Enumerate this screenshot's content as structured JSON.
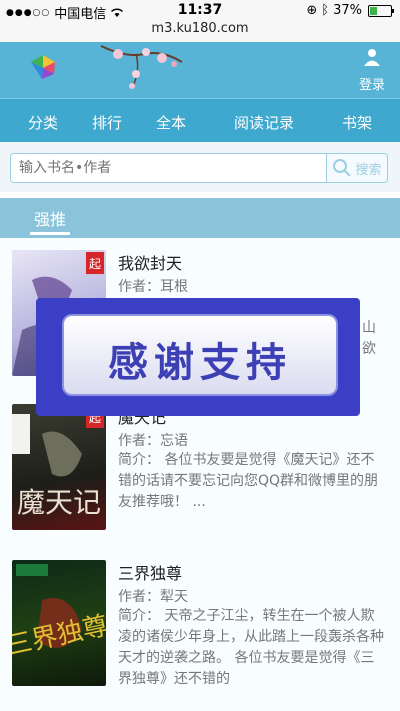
{
  "status_bar": {
    "carrier": "中国电信",
    "time": "11:37",
    "battery": "37%",
    "battery_level": 0.37
  },
  "url": "m3.ku180.com",
  "header": {
    "login_label": "登录"
  },
  "nav": {
    "items": [
      "分类",
      "排行",
      "全本",
      "阅读记录",
      "书架"
    ]
  },
  "search": {
    "placeholder": "输入书名•作者",
    "button_label": "搜索"
  },
  "section": {
    "title": "强推"
  },
  "books": [
    {
      "title": "我欲封天",
      "author": "作者：耳根",
      "summary_lines": [
        "山",
        "欲"
      ]
    },
    {
      "title": "魔天记",
      "author": "作者：忘语",
      "summary": "简介： 各位书友要是觉得《魔天记》还不错的话请不要忘记向您QQ群和微博里的朋友推荐哦！ ..."
    },
    {
      "title": "三界独尊",
      "author": "作者：犁天",
      "summary": "简介： 天帝之子江尘，转生在一个被人欺凌的诸侯少年身上，从此踏上一段轰杀各种天才的逆袭之路。 各位书友要是觉得《三界独尊》还不错的"
    }
  ],
  "overlay": {
    "text": "感谢支持"
  }
}
